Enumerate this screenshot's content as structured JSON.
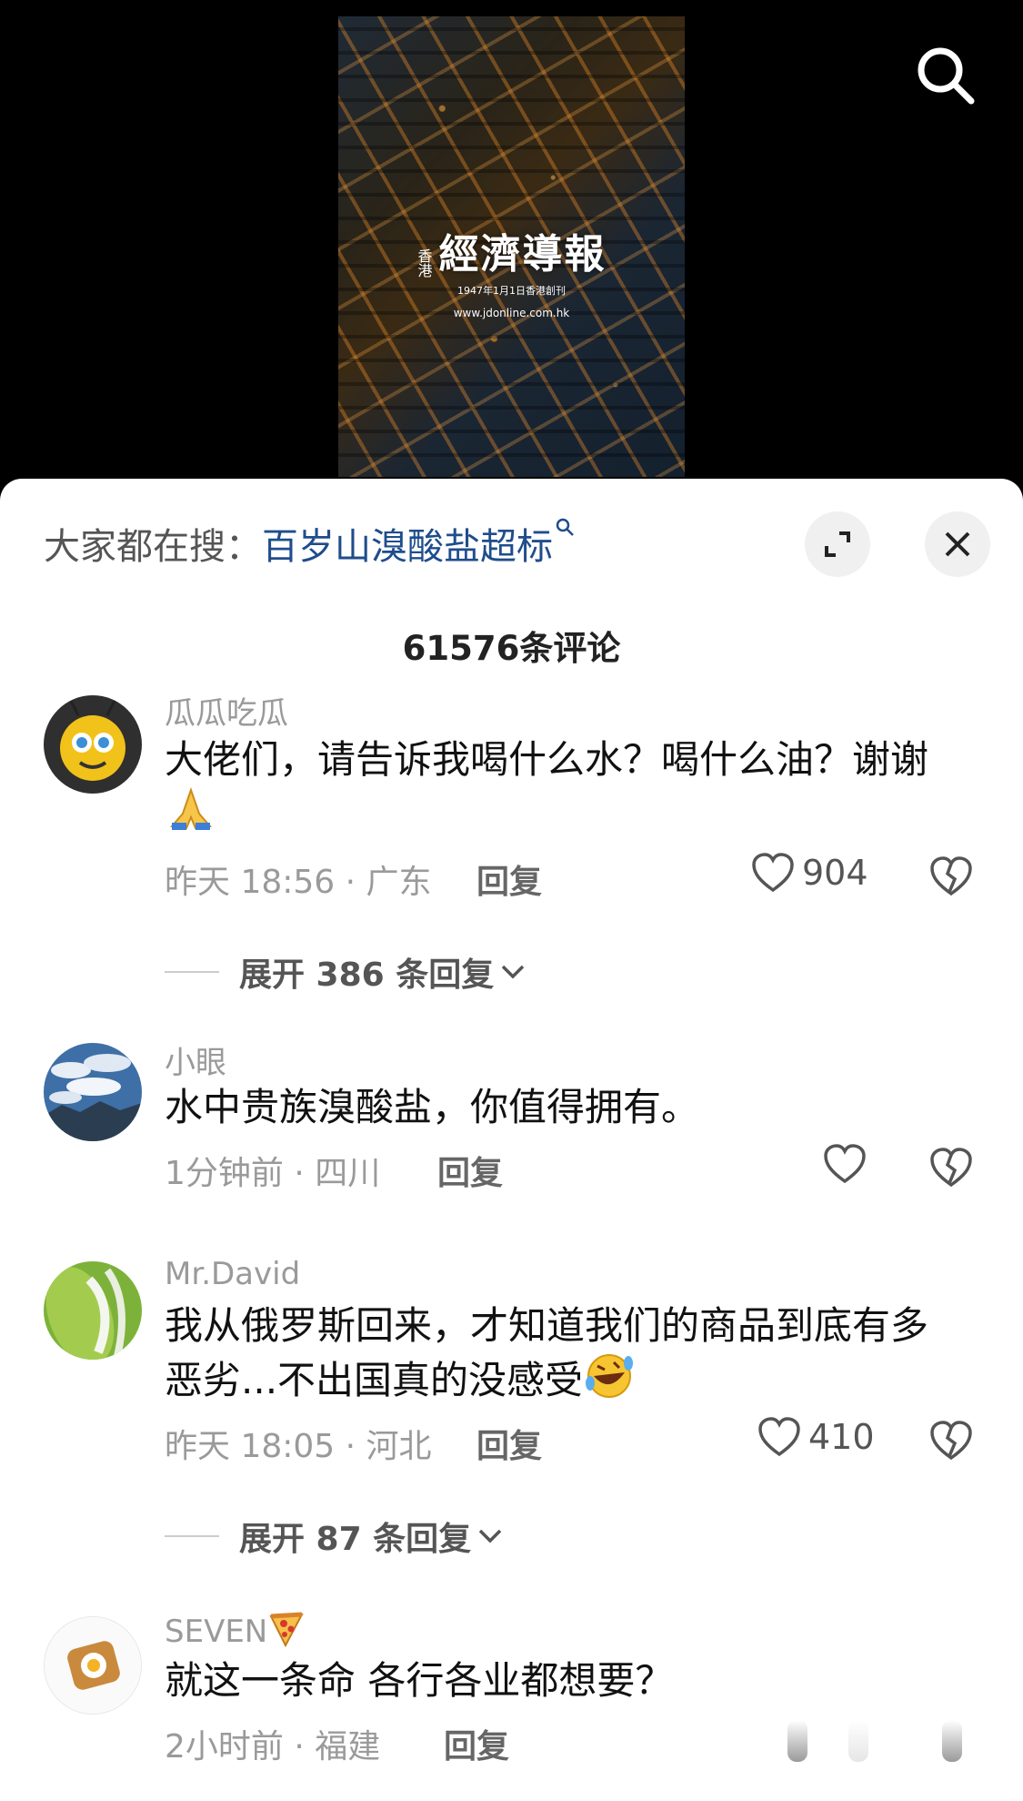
{
  "video": {
    "logo_side": "香港",
    "logo_main": "經濟導報",
    "logo_sub": "1947年1月1日香港創刊",
    "logo_url": "www.jdonline.com.hk"
  },
  "panel": {
    "search_label": "大家都在搜：",
    "search_query": "百岁山溴酸盐超标",
    "comment_count": "61576条评论"
  },
  "comments": [
    {
      "name": "瓜瓜吃瓜",
      "text": "大佬们，请告诉我喝什么水？喝什么油？谢谢",
      "emoji": "folded-hands",
      "time": "昨天 18:56 · 广东",
      "reply": "回复",
      "likes": "904",
      "expand": "展开 386 条回复"
    },
    {
      "name": "小眼",
      "text": "水中贵族溴酸盐，你值得拥有。",
      "time": "1分钟前 · 四川",
      "reply": "回复",
      "likes": ""
    },
    {
      "name": "Mr.David",
      "text": "我从俄罗斯回来，才知道我们的商品到底有多恶劣...不出国真的没感受",
      "emoji": "rolling-laughing",
      "time": "昨天 18:05 · 河北",
      "reply": "回复",
      "likes": "410",
      "expand": "展开 87 条回复"
    },
    {
      "name": "SEVEN",
      "name_emoji": "pizza",
      "text": "就这一条命 各行各业都想要？",
      "time": "2小时前 · 福建",
      "reply": "回复"
    }
  ]
}
